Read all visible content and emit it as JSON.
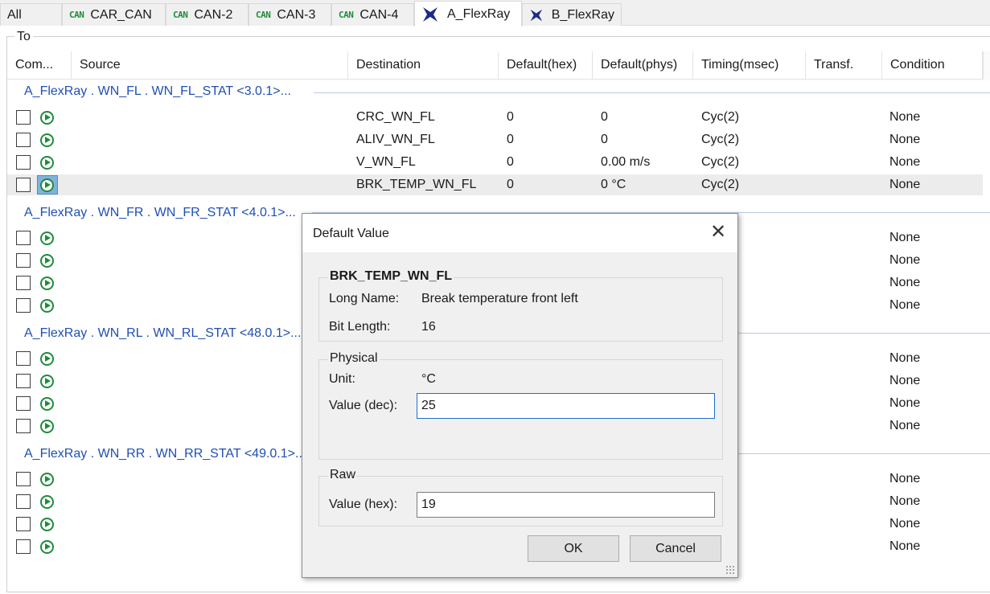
{
  "tabs": [
    {
      "label": "All",
      "icon": null
    },
    {
      "label": "CAR_CAN",
      "icon": "can-badge",
      "badge": "CAN"
    },
    {
      "label": "CAN-2",
      "icon": "can-badge",
      "badge": "CAN"
    },
    {
      "label": "CAN-3",
      "icon": "can-badge",
      "badge": "CAN"
    },
    {
      "label": "CAN-4",
      "icon": "can-badge",
      "badge": "CAN"
    },
    {
      "label": "A_FlexRay",
      "icon": "flexray-icon"
    },
    {
      "label": "B_FlexRay",
      "icon": "flexray-icon"
    }
  ],
  "groupbox_label": "To",
  "columns": [
    "Com...",
    "Source",
    "Destination",
    "Default(hex)",
    "Default(phys)",
    "Timing(msec)",
    "Transf.",
    "Condition"
  ],
  "groups": [
    {
      "title": "A_FlexRay . WN_FL . WN_FL_STAT <3.0.1>...",
      "rows": [
        {
          "destination": "CRC_WN_FL",
          "default_hex": "0",
          "default_phys": "0",
          "timing": "Cyc(2)",
          "condition": "None"
        },
        {
          "destination": "ALIV_WN_FL",
          "default_hex": "0",
          "default_phys": "0",
          "timing": "Cyc(2)",
          "condition": "None"
        },
        {
          "destination": "V_WN_FL",
          "default_hex": "0",
          "default_phys": "0.00 m/s",
          "timing": "Cyc(2)",
          "condition": "None"
        },
        {
          "destination": "BRK_TEMP_WN_FL",
          "default_hex": "0",
          "default_phys": "0 °C",
          "timing": "Cyc(2)",
          "condition": "None",
          "selected": true
        }
      ]
    },
    {
      "title": "A_FlexRay . WN_FR . WN_FR_STAT <4.0.1>...",
      "rows": [
        {
          "condition": "None"
        },
        {
          "condition": "None"
        },
        {
          "condition": "None"
        },
        {
          "condition": "None"
        }
      ]
    },
    {
      "title": "A_FlexRay . WN_RL . WN_RL_STAT <48.0.1>...",
      "rows": [
        {
          "condition": "None"
        },
        {
          "condition": "None"
        },
        {
          "condition": "None"
        },
        {
          "condition": "None"
        }
      ]
    },
    {
      "title": "A_FlexRay . WN_RR . WN_RR_STAT <49.0.1>...",
      "rows": [
        {
          "condition": "None"
        },
        {
          "condition": "None"
        },
        {
          "condition": "None"
        },
        {
          "condition": "None"
        }
      ]
    }
  ],
  "dialog": {
    "title": "Default Value",
    "signal_name": "BRK_TEMP_WN_FL",
    "long_name_label": "Long Name:",
    "long_name": "Break temperature front left",
    "bit_length_label": "Bit Length:",
    "bit_length": "16",
    "physical_legend": "Physical",
    "unit_label": "Unit:",
    "unit": "°C",
    "value_dec_label": "Value (dec):",
    "value_dec": "25",
    "raw_legend": "Raw",
    "value_hex_label": "Value (hex):",
    "value_hex": "19",
    "ok_label": "OK",
    "cancel_label": "Cancel"
  },
  "colors": {
    "group_title": "#1f4fb4",
    "can_badge": "#1e8c3a",
    "flexray_icon": "#1a2a8c",
    "selection": "#7fb3de"
  }
}
